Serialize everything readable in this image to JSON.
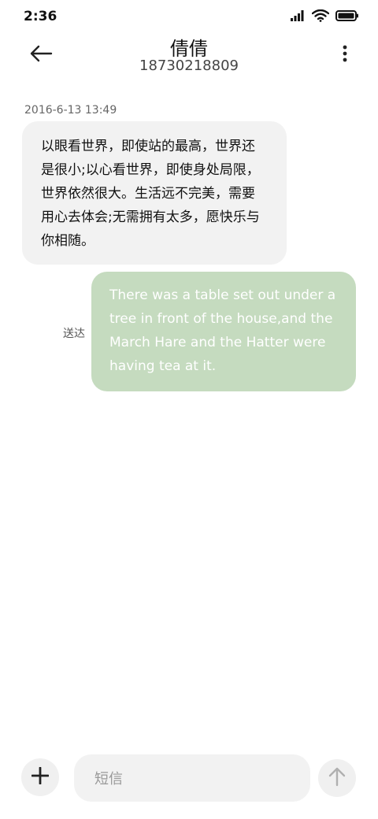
{
  "status_bar": {
    "time": "2:36"
  },
  "header": {
    "contact_name": "倩倩",
    "contact_phone": "18730218809"
  },
  "conversation": {
    "timestamp": "2016-6-13 13:49",
    "incoming_text": "以眼看世界，即使站的最高，世界还是很小;以心看世界，即使身处局限，世界依然很大。生活远不完美，需要用心去体会;无需拥有太多，愿快乐与你相随。",
    "outgoing_text": "There was a table set out under a tree in front of the house,and the March Hare and the Hatter were having tea at it.",
    "delivery_status": "送达"
  },
  "composer": {
    "placeholder": "短信"
  },
  "colors": {
    "incoming_bubble": "#f2f2f2",
    "outgoing_bubble": "#c5dbbf",
    "icon_dark": "#222222",
    "icon_muted": "#b0b0b0"
  },
  "icons": {
    "back": "arrow-left-icon",
    "more": "more-vertical-icon",
    "add": "plus-icon",
    "send": "arrow-up-icon",
    "signal": "signal-icon",
    "wifi": "wifi-icon",
    "battery": "battery-icon"
  }
}
